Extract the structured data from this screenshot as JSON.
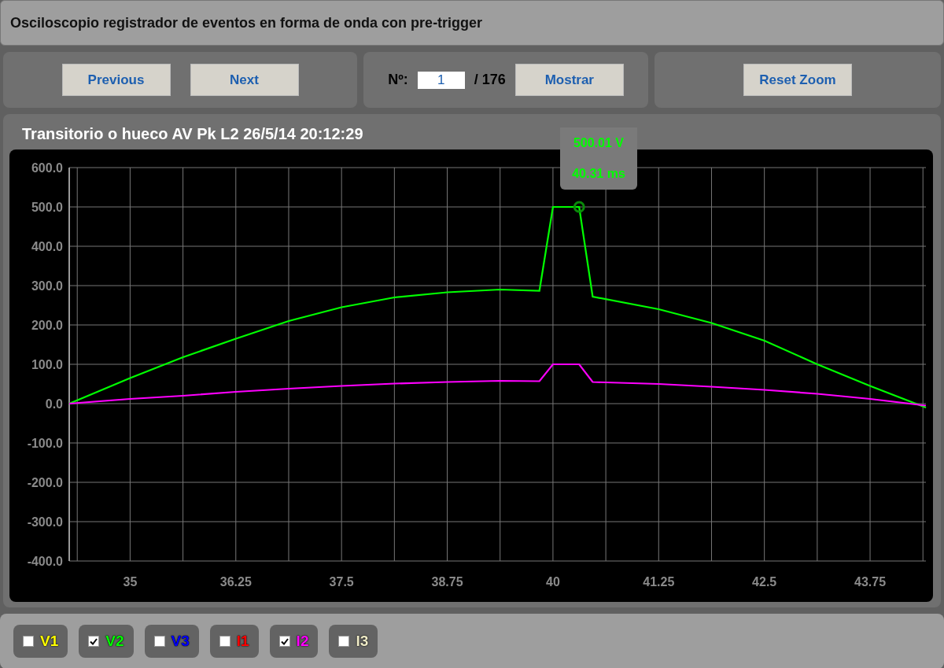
{
  "window": {
    "title": "Osciloscopio registrador de eventos en forma de onda con pre-trigger"
  },
  "navigation": {
    "buttons": [
      "Previous",
      "Next"
    ]
  },
  "record_selector": {
    "label": "Nº:",
    "value": "1",
    "total": "/ 176",
    "button": "Mostrar"
  },
  "zoom": {
    "button": "Reset Zoom"
  },
  "chart_panel": {
    "title": "Transitorio o hueco AV Pk L2 26/5/14 20:12:29",
    "tooltip": {
      "value": "500.01 V",
      "time": "40.31 ms",
      "color": "#00ff00"
    },
    "chart_data": {
      "type": "line",
      "grid": true,
      "xlim": [
        34.28,
        44.41
      ],
      "ylim": [
        -400,
        600
      ],
      "xticks": [
        {
          "value": 35,
          "label": "35"
        },
        {
          "value": 36.25,
          "label": "36.25"
        },
        {
          "value": 37.5,
          "label": "37.5"
        },
        {
          "value": 38.75,
          "label": "38.75"
        },
        {
          "value": 40,
          "label": "40"
        },
        {
          "value": 41.25,
          "label": "41.25"
        },
        {
          "value": 42.5,
          "label": "42.5"
        },
        {
          "value": 43.75,
          "label": "43.75"
        }
      ],
      "yticks": [
        {
          "value": 600,
          "label": "600.0"
        },
        {
          "value": 500,
          "label": "500.0"
        },
        {
          "value": 400,
          "label": "400.0"
        },
        {
          "value": 300,
          "label": "300.0"
        },
        {
          "value": 200,
          "label": "200.0"
        },
        {
          "value": 100,
          "label": "100.0"
        },
        {
          "value": 0,
          "label": "0.0"
        },
        {
          "value": -100,
          "label": "-100.0"
        },
        {
          "value": -200,
          "label": "-200.0"
        },
        {
          "value": -300,
          "label": "-300.0"
        },
        {
          "value": -400,
          "label": "-400.0"
        }
      ],
      "x": [
        34.28,
        35,
        35.625,
        36.25,
        36.875,
        37.5,
        38.125,
        38.75,
        39.375,
        39.84,
        40,
        40.31,
        40.47,
        41.25,
        41.875,
        42.5,
        43.125,
        43.75,
        44.41
      ],
      "series": [
        {
          "color": "#00ff00",
          "values": [
            0,
            65,
            118,
            165,
            210,
            245,
            270,
            283,
            290,
            287,
            500,
            500,
            272,
            240,
            205,
            160,
            100,
            45,
            -10
          ]
        },
        {
          "color": "#ff00ff",
          "values": [
            0,
            12,
            20,
            30,
            38,
            45,
            51,
            55,
            58,
            57,
            100,
            100,
            55,
            50,
            43,
            35,
            25,
            12,
            -5
          ]
        }
      ]
    }
  },
  "channels": [
    {
      "name": "V1",
      "checked": false,
      "color": "#ffff00"
    },
    {
      "name": "V2",
      "checked": true,
      "color": "#00ff00"
    },
    {
      "name": "V3",
      "checked": false,
      "color": "#0000ff"
    },
    {
      "name": "I1",
      "checked": false,
      "color": "#ff0000"
    },
    {
      "name": "I2",
      "checked": true,
      "color": "#ff00ff"
    },
    {
      "name": "I3",
      "checked": false,
      "color": "#f0ecc8"
    }
  ]
}
